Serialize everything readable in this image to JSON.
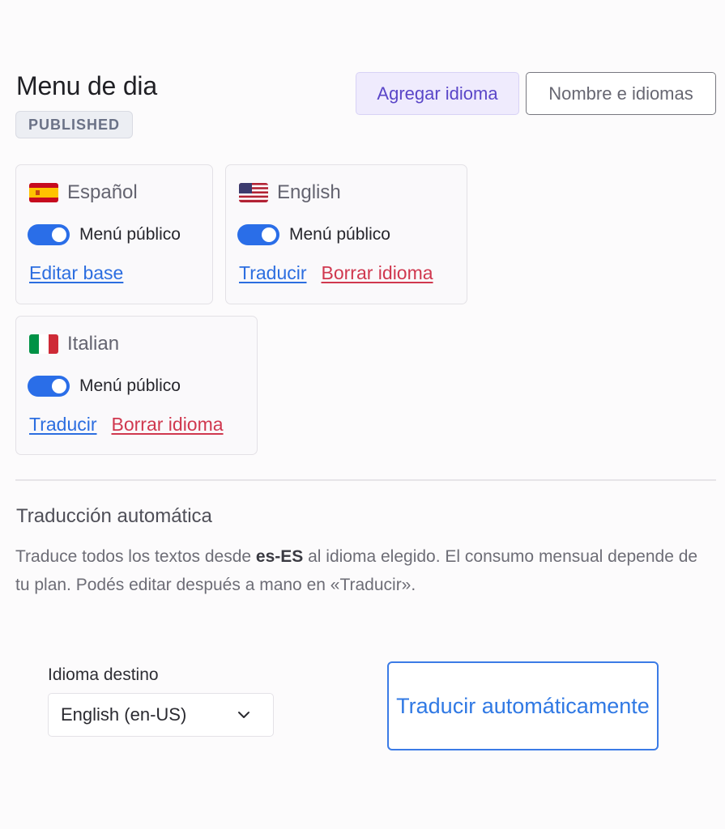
{
  "header": {
    "title": "Menu de dia",
    "status": "PUBLISHED",
    "add_language_label": "Agregar idioma",
    "name_languages_label": "Nombre e idiomas"
  },
  "languages": [
    {
      "name": "Español",
      "flag_icon": "spain-flag-icon",
      "public_label": "Menú público",
      "public_enabled": true,
      "primary_action": "Editar base"
    },
    {
      "name": "English",
      "flag_icon": "usa-flag-icon",
      "public_label": "Menú público",
      "public_enabled": true,
      "primary_action": "Traducir",
      "delete_action": "Borrar idioma"
    },
    {
      "name": "Italian",
      "flag_icon": "italy-flag-icon",
      "public_label": "Menú público",
      "public_enabled": true,
      "primary_action": "Traducir",
      "delete_action": "Borrar idioma"
    }
  ],
  "auto_translate": {
    "title": "Traducción automática",
    "desc_before": "Traduce todos los textos desde ",
    "desc_source_locale": "es-ES",
    "desc_after": " al idioma elegido. El consumo mensual depende de tu plan. Podés editar después a mano en «Traducir».",
    "target_label": "Idioma destino",
    "target_value": "English (en-US)",
    "button_label": "Traducir automáticamente"
  },
  "colors": {
    "accent_blue": "#2a6ee8",
    "danger_red": "#d0384f",
    "purple": "#5a46c8"
  }
}
